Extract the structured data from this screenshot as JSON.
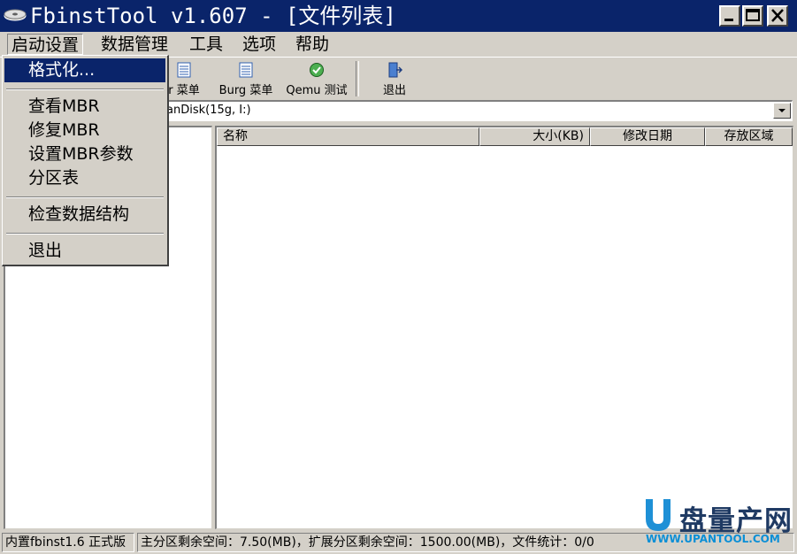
{
  "window": {
    "title": "FbinstTool v1.607 - [文件列表]",
    "minimize_icon": "minimize-icon",
    "maximize_icon": "maximize-icon",
    "close_icon": "close-icon",
    "app_icon": "drive-icon"
  },
  "menubar": {
    "items": [
      {
        "label": "启动设置"
      },
      {
        "label": "数据管理"
      },
      {
        "label": "工具"
      },
      {
        "label": "选项"
      },
      {
        "label": "帮助"
      }
    ]
  },
  "toolbar": {
    "buttons": [
      {
        "label": "r 菜单",
        "icon": "menu-list-icon"
      },
      {
        "label": "Burg 菜单",
        "icon": "menu-list-icon"
      },
      {
        "label": "Qemu 测试",
        "icon": "qemu-icon"
      },
      {
        "label": "退出",
        "icon": "exit-door-icon"
      }
    ]
  },
  "drive_select": {
    "value": "anDisk(15g, I:)"
  },
  "file_list": {
    "columns": [
      "名称",
      "大小(KB)",
      "修改日期",
      "存放区域"
    ],
    "rows": []
  },
  "dropdown": {
    "items": [
      {
        "label": "格式化...",
        "selected": true
      },
      {
        "label": "查看MBR"
      },
      {
        "label": "修复MBR"
      },
      {
        "label": "设置MBR参数"
      },
      {
        "label": "分区表"
      },
      {
        "label": "检查数据结构"
      },
      {
        "label": "退出"
      }
    ]
  },
  "statusbar": {
    "version": "内置fbinst1.6 正式版",
    "space": "主分区剩余空间：7.50(MB)，扩展分区剩余空间：1500.00(MB)，文件统计：0/0"
  },
  "watermark": {
    "brand": "盘量产网",
    "url": "WWW.UPANTOOL.COM"
  },
  "colors": {
    "titlebar": "#0a246a",
    "face": "#d4d0c8",
    "highlight": "#0a246a"
  }
}
